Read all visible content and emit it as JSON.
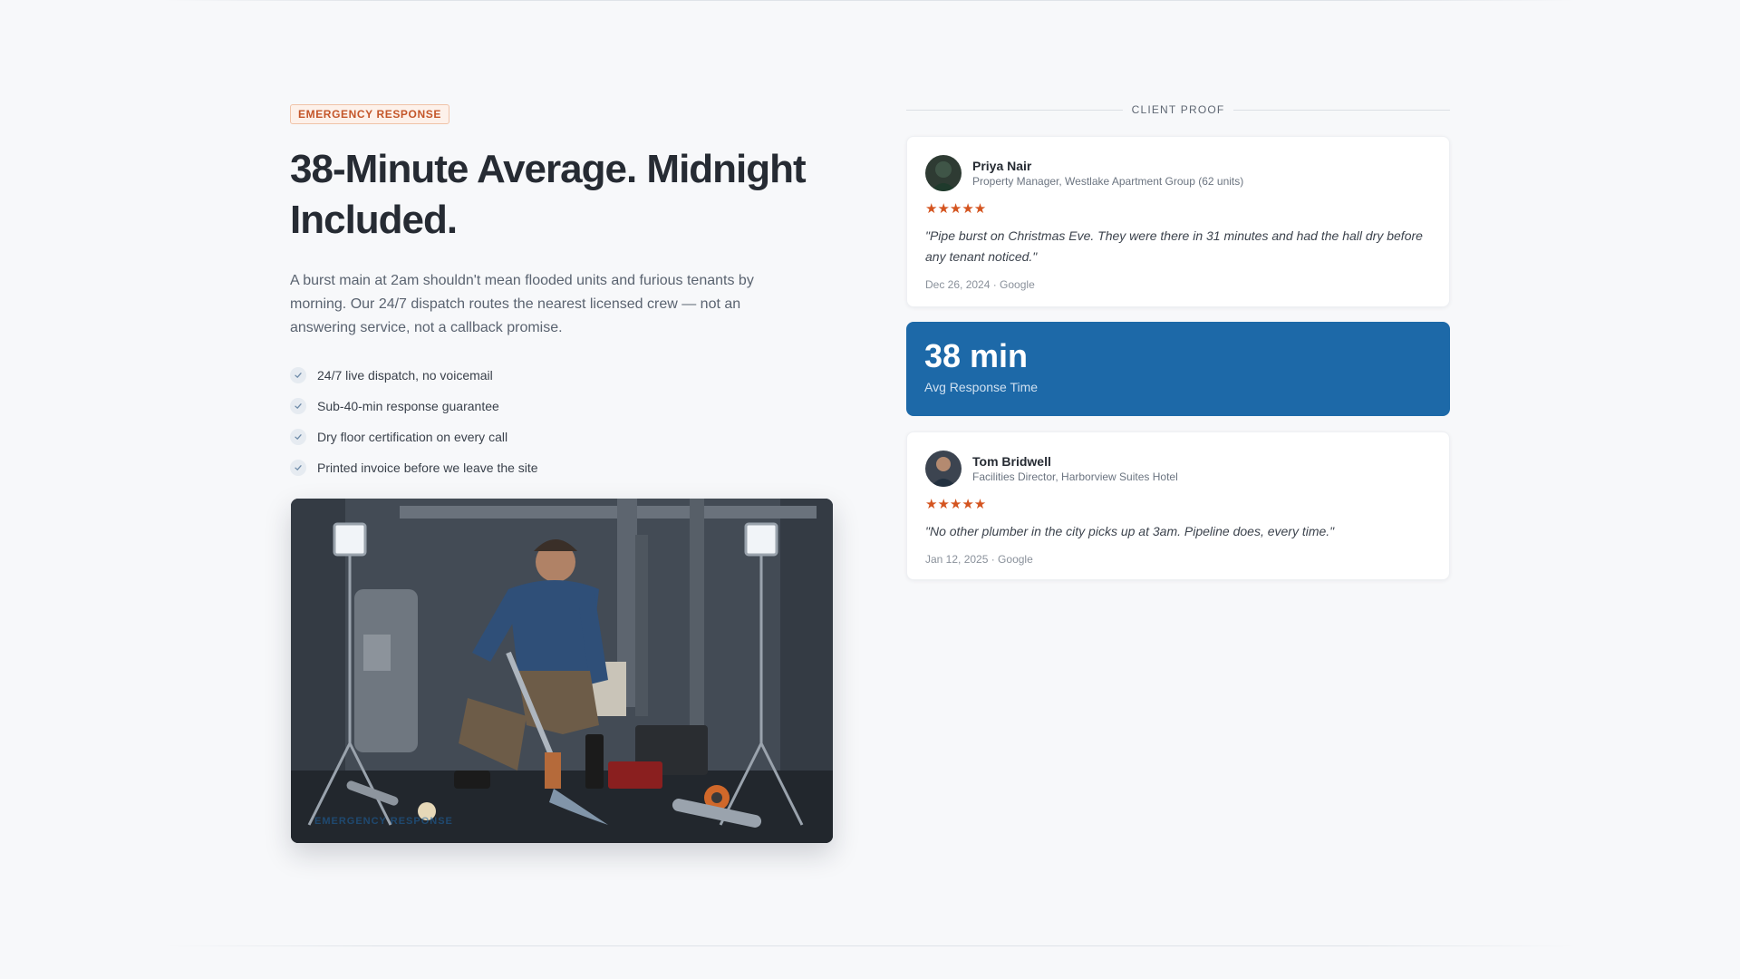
{
  "hero": {
    "badge": "EMERGENCY RESPONSE",
    "headline": "38-Minute Average. Midnight Included.",
    "lead": "A burst main at 2am shouldn't mean flooded units and furious tenants by morning. Our 24/7 dispatch routes the nearest licensed crew — not an answering service, not a callback promise.",
    "features": [
      "24/7 live dispatch, no voicemail",
      "Sub-40-min response guarantee",
      "Dry floor certification on every call",
      "Printed invoice before we leave the site"
    ],
    "photo_caption": "EMERGENCY RESPONSE"
  },
  "proof": {
    "title": "CLIENT PROOF",
    "reviews": [
      {
        "name": "Priya Nair",
        "role": "Property Manager, Westlake Apartment Group (62 units)",
        "rating": 5,
        "stars": "★★★★★",
        "quote": "\"Pipe burst on Christmas Eve. They were there in 31 minutes and had the hall dry before any tenant noticed.\"",
        "meta": "Dec 26, 2024 · Google"
      },
      {
        "name": "Tom Bridwell",
        "role": "Facilities Director, Harborview Suites Hotel",
        "rating": 5,
        "stars": "★★★★★",
        "quote": "\"No other plumber in the city picks up at 3am. Pipeline does, every time.\"",
        "meta": "Jan 12, 2025 · Google"
      }
    ],
    "stat": {
      "value": "38 min",
      "label": "Avg Response Time"
    }
  },
  "colors": {
    "accent_blue": "#1d69a8",
    "badge_orange": "#c4562a",
    "star_orange": "#d4541f",
    "background": "#f7f8fa"
  },
  "icons": {
    "feature_check": "check-icon",
    "rating": "star-icon"
  }
}
